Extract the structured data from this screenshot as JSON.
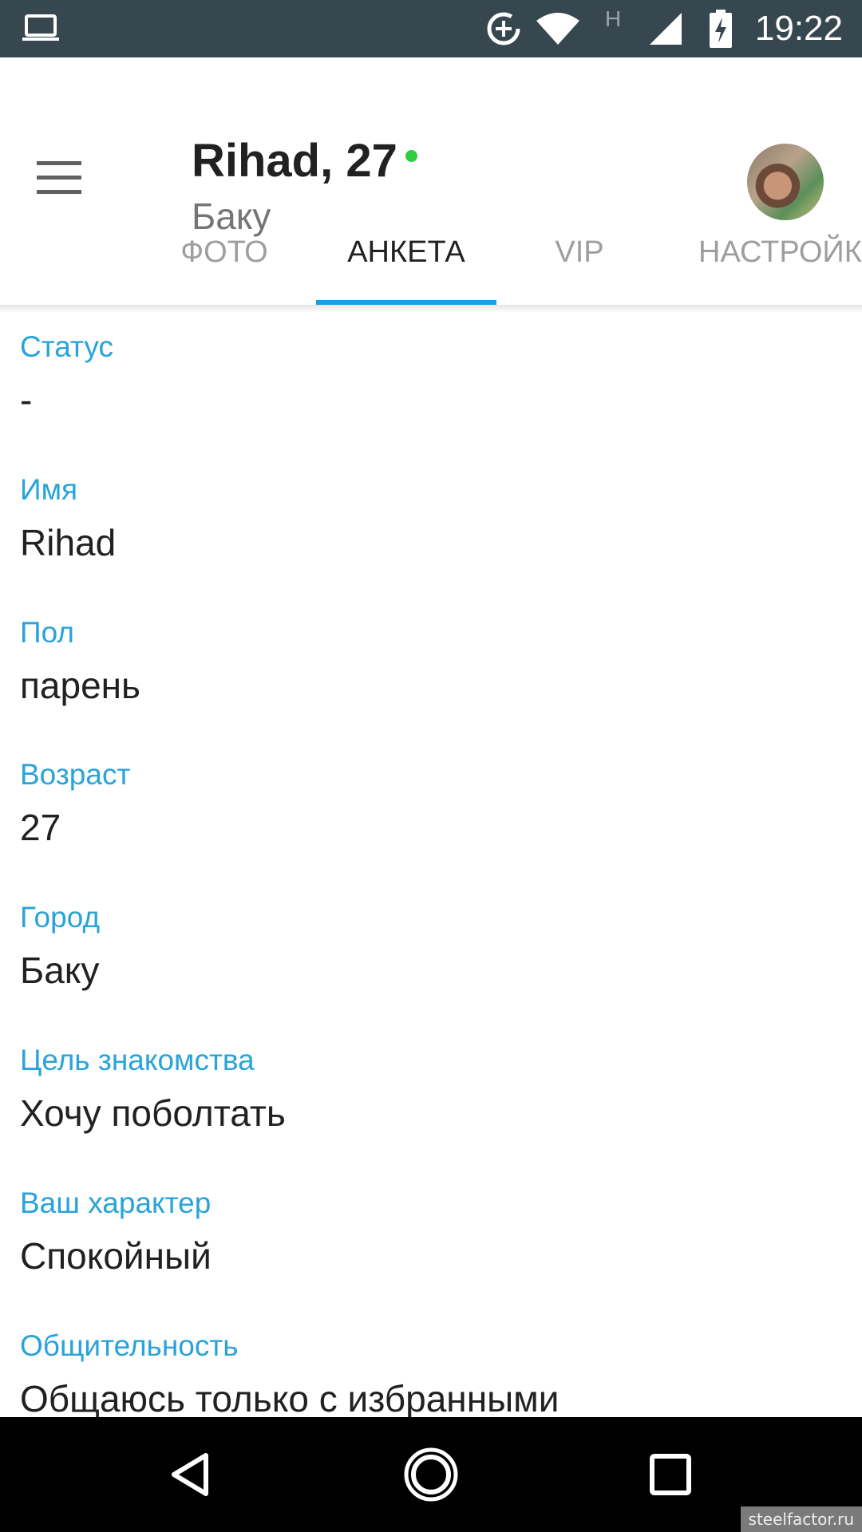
{
  "status_bar": {
    "time": "19:22",
    "network_type": "H",
    "icons": [
      "laptop-icon",
      "data-saver-icon",
      "wifi-icon",
      "network-h-icon",
      "signal-icon",
      "battery-charging-icon"
    ]
  },
  "header": {
    "menu_icon": "hamburger-menu-icon",
    "name": "Rihad, 27",
    "city": "Баку",
    "online_color": "#2ecc40"
  },
  "tabs": [
    {
      "label": "ФОТО",
      "active": false
    },
    {
      "label": "АНКЕТА",
      "active": true
    },
    {
      "label": "VIP",
      "active": false
    },
    {
      "label": "НАСТРОЙК",
      "active": false
    }
  ],
  "profile_fields": [
    {
      "label": "Статус",
      "value": "-"
    },
    {
      "label": "Имя",
      "value": "Rihad"
    },
    {
      "label": "Пол",
      "value": "парень"
    },
    {
      "label": "Возраст",
      "value": "27"
    },
    {
      "label": "Город",
      "value": "Баку"
    },
    {
      "label": "Цель знакомства",
      "value": "Хочу поболтать"
    },
    {
      "label": "Ваш характер",
      "value": "Спокойный"
    },
    {
      "label": "Общительность",
      "value": "Общаюсь только с избранными"
    }
  ],
  "nav_bar": {
    "back": "back-triangle-icon",
    "home": "home-circle-icon",
    "recents": "recents-square-icon"
  },
  "watermark": "steelfactor.ru",
  "colors": {
    "status_bar": "#37474f",
    "accent": "#1ba1e2",
    "label": "#29a3da"
  }
}
